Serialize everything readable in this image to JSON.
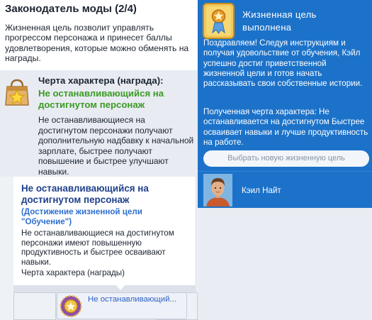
{
  "aspiration": {
    "title": "Законодатель моды (2/4)",
    "description": "Жизненная цель позволит управлять прогрессом персонажа и принесет баллы удовлетворения, которые можно обменять на награды.",
    "reward_heading": "Черта характера (награда):",
    "reward_trait_name": "Не останавливающийся на достигнутом персонаж",
    "reward_description": "Не останавливающиеся на достигнутом персонажи получают дополнительную надбавку к начальной зарплате, быстрее получают повышение и быстрее улучшают навыки."
  },
  "tooltip": {
    "title": "Не останавливающийся на достигнутом персонаж",
    "subtitle": "(Достижение жизненной цели \"Обучение\")",
    "description": "Не останавливающиеся на достигнутом персонажи имеют повышенную продуктивность и быстрее осваивают навыки.",
    "type": "Черта характера (награды)"
  },
  "trait_slot": {
    "label": "Не останавливающий...",
    "icon": "medal-icon"
  },
  "notification": {
    "title": "Жизненная цель выполнена",
    "message": "Поздравляем! Следуя инструкциям и получая удовольствие от обучения, Кэйл успешно достиг приветственной жизненной цели и готов начать рассказывать свои собственные истории.",
    "reward_text": "Полученная черта характера: Не останавливается на достигнутом Быстрее осваивает навыки и лучше продуктивность на работе.",
    "button_label": "Выбрать новую жизненную цель",
    "sim_name": "Кэил Найт",
    "badge_icon": "aspiration-badge-icon"
  },
  "colors": {
    "accent_blue": "#1c72c9",
    "trait_green": "#3c9a25",
    "tooltip_title": "#1f3f8c",
    "tooltip_subtitle": "#2f6fd0"
  }
}
